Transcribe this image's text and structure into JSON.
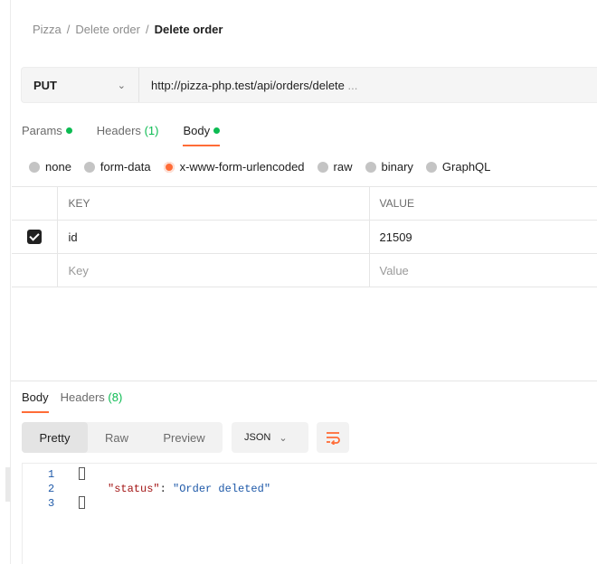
{
  "breadcrumb": {
    "root": "Pizza",
    "folder": "Delete order",
    "current": "Delete order",
    "separator": "/"
  },
  "request": {
    "method": "PUT",
    "url": "http://pizza-php.test/api/orders/delete",
    "url_ellipsis": " ..."
  },
  "request_tabs": [
    {
      "label": "Params",
      "count": ""
    },
    {
      "label": "Headers",
      "count": "(1)"
    },
    {
      "label": "Body",
      "count": ""
    }
  ],
  "body_types": [
    "none",
    "form-data",
    "x-www-form-urlencoded",
    "raw",
    "binary",
    "GraphQL"
  ],
  "body_type_selected": "x-www-form-urlencoded",
  "params_table": {
    "headers": {
      "key": "KEY",
      "value": "VALUE"
    },
    "rows": [
      {
        "checked": true,
        "key": "id",
        "value": "21509"
      }
    ],
    "placeholder": {
      "key": "Key",
      "value": "Value"
    }
  },
  "response_tabs": [
    {
      "label": "Body",
      "count": ""
    },
    {
      "label": "Headers",
      "count": "(8)"
    }
  ],
  "view_modes": [
    "Pretty",
    "Raw",
    "Preview"
  ],
  "view_mode_selected": "Pretty",
  "format": "JSON",
  "code_lines": {
    "n1": "1",
    "n2": "2",
    "n3": "3",
    "key": "\"status\"",
    "colon": ": ",
    "value": "\"Order deleted\""
  },
  "colors": {
    "accent": "#ff6c37",
    "success": "#0cbb52"
  },
  "icons": {
    "wrap": "wrap-lines-icon",
    "chevron": "chevron-down-icon",
    "check": "checkbox-checked-icon"
  }
}
